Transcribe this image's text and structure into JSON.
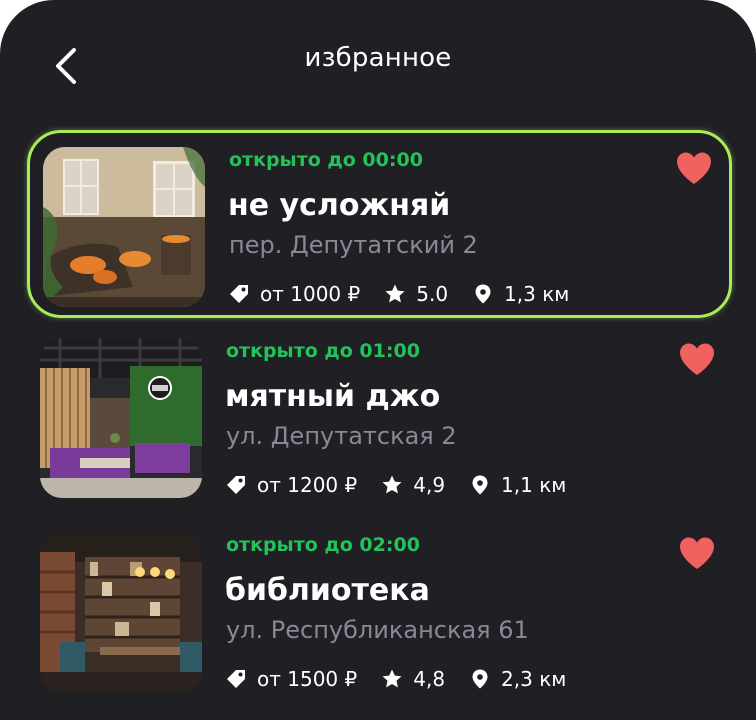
{
  "header": {
    "title": "избранное"
  },
  "colors": {
    "background": "#1f1f24",
    "accent_border": "#a9ec5a",
    "status_open": "#23c25a",
    "heart": "#f0615f",
    "address": "#878a96"
  },
  "icons": {
    "back": "chevron-left-icon",
    "price": "price-tag-icon",
    "rating": "star-icon",
    "distance": "location-pin-icon",
    "favorite": "heart-icon"
  },
  "places": [
    {
      "status": "открыто до 00:00",
      "name": "не усложняй",
      "address": "пер. Депутатский 2",
      "price": "от 1000 ₽",
      "rating": "5.0",
      "distance": "1,3 км",
      "selected": true,
      "favorite": true
    },
    {
      "status": "открыто до 01:00",
      "name": "мятный джо",
      "address": "ул. Депутатская 2",
      "price": "от 1200 ₽",
      "rating": "4,9",
      "distance": "1,1 км",
      "selected": false,
      "favorite": true
    },
    {
      "status": "открыто до 02:00",
      "name": "библиотека",
      "address": "ул. Республиканская 61",
      "price": "от 1500 ₽",
      "rating": "4,8",
      "distance": "2,3 км",
      "selected": false,
      "favorite": true
    }
  ]
}
